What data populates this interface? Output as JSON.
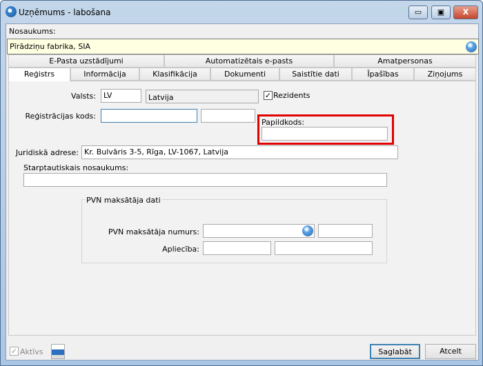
{
  "window": {
    "title": "Uzņēmums - labošana",
    "minimize": "▭",
    "maximize": "▣",
    "close": "X"
  },
  "name": {
    "label": "Nosaukums:",
    "value": "Pīrādziņu fabrika, SIA"
  },
  "tabs_row1": [
    "E-Pasta uzstādījumi",
    "Automatizētais e-pasts",
    "Amatpersonas"
  ],
  "tabs_row2": [
    "Reģistrs",
    "Informācija",
    "Klasifikācija",
    "Dokumenti",
    "Saistītie dati",
    "Īpašības",
    "Ziņojums"
  ],
  "form": {
    "country_label": "Valsts:",
    "country_code": "LV",
    "country_name": "Latvija",
    "resident_label": "Rezidents",
    "resident_checked": true,
    "reg_code_label": "Reģistrācijas kods:",
    "reg_code": "",
    "reg_code2": "",
    "extra_code_label": "Papildkods:",
    "extra_code": "",
    "address_label": "Juridiskā adrese:",
    "address": "Kr. Bulvāris 3-5, Rīga, LV-1067, Latvija",
    "intl_name_label": "Starptautiskais nosaukums:",
    "intl_name": "",
    "vat_group": "PVN maksātāja dati",
    "vat_number_label": "PVN maksātāja numurs:",
    "vat_number": "",
    "vat_extra": "",
    "certificate_label": "Apliecība:",
    "certificate": "",
    "certificate2": ""
  },
  "footer": {
    "active_label": "Aktīvs",
    "active_checked": true,
    "save": "Saglabāt",
    "cancel": "Atcelt"
  },
  "colors": {
    "highlight": "#e00000",
    "name_field_bg": "#ffffe1",
    "focus": "#3c7fb1"
  }
}
